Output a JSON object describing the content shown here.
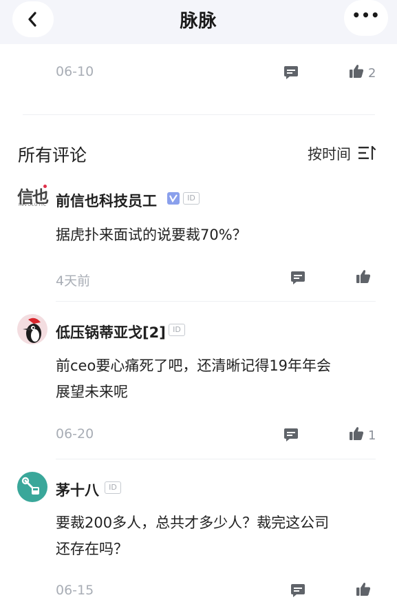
{
  "nav": {
    "title": "脉脉"
  },
  "post": {
    "date": "06-10",
    "like_count": "2"
  },
  "comments_section": {
    "title": "所有评论",
    "sort_label": "按时间"
  },
  "comments": [
    {
      "user": "前信也科技员工",
      "avatar_text": "信也",
      "avatar_subtext": "INVOLUTIC",
      "verified": true,
      "content_lines": [
        "据虎扑来面试的说要裁70%？"
      ],
      "time": "4天前",
      "like_count": ""
    },
    {
      "user": "低压锅蒂亚戈[2]",
      "verified": false,
      "content_lines": [
        "前ceo要心痛死了吧，还清晰记得19年年会",
        "展望未来呢"
      ],
      "time": "06-20",
      "like_count": "1"
    },
    {
      "user": "茅十八",
      "verified": false,
      "content_lines": [
        "要裁200多人，总共才多少人？裁完这公司",
        "还存在吗？"
      ],
      "time": "06-15",
      "like_count": ""
    }
  ],
  "badges": {
    "id": "ID"
  },
  "icons": {
    "back": "chevron-left-icon",
    "more": "more-dots-icon",
    "comment": "comment-icon",
    "like": "thumbs-up-icon",
    "sort": "sort-lines-icon"
  },
  "colors": {
    "nav_bg": "#f4f5fa",
    "icon": "#5f6369",
    "meta": "#a8adb5",
    "verified": "#8aa0ec"
  }
}
